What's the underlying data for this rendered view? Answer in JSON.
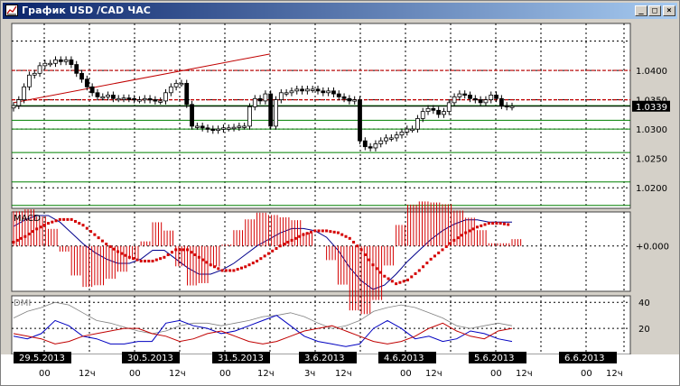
{
  "window": {
    "title": "График USD /CAD  ЧАС",
    "minimize_glyph": "_",
    "maximize_glyph": "□",
    "close_glyph": "×"
  },
  "colors": {
    "background": "#ffffff",
    "grid": "#000000",
    "resistance": "#c00000",
    "support": "#008000",
    "trendline": "#c00000",
    "candle": "#000000",
    "macd_line": "#00008b",
    "macd_signal": "#d40000",
    "macd_hist": "#d40000",
    "dmi_plus": "#0000c0",
    "dmi_minus": "#c00000",
    "dmi_adx": "#808080",
    "date_label_bg": "#000000",
    "date_label_fg": "#ffffff",
    "price_tag_bg": "#000000"
  },
  "price_panel": {
    "yaxis_labels": [
      "1.0400",
      "1.0350",
      "1.0300",
      "1.0250",
      "1.0200"
    ],
    "current_price_label": "1.0339"
  },
  "macd_panel": {
    "label": "MACD",
    "zero_label": "+0.000"
  },
  "dmi_panel": {
    "label": "DMI",
    "yaxis_labels": [
      "40",
      "20"
    ]
  },
  "time_axis": {
    "dates": [
      "29.5.2013",
      "30.5.2013",
      "31.5.2013",
      "3.6.2013",
      "4.6.2013",
      "5.6.2013",
      "6.6.2013"
    ],
    "hour_labels": [
      "00",
      "12ч",
      "00",
      "12ч",
      "00",
      "12ч",
      "3ч",
      "12ч",
      "00",
      "12ч",
      "00",
      "12ч",
      "00",
      "12ч"
    ]
  },
  "chart_data": {
    "type": "candlestick",
    "title": "График USD /CAD  ЧАС",
    "timeframe": "ЧАС",
    "ylim": [
      1.0165,
      1.048
    ],
    "horizontal_levels": {
      "resistance": [
        1.04,
        1.035
      ],
      "support": [
        1.034,
        1.0315,
        1.03,
        1.026,
        1.021,
        1.017
      ]
    },
    "trendline": {
      "from": {
        "date": "29.5.2013",
        "price": 1.0345
      },
      "to": {
        "date": "31.5.2013 ~12ч",
        "price": 1.0428
      }
    },
    "close_series_approx": [
      1.034,
      1.035,
      1.0372,
      1.0392,
      1.0395,
      1.0408,
      1.0412,
      1.0412,
      1.0418,
      1.0415,
      1.0418,
      1.041,
      1.0395,
      1.0385,
      1.0372,
      1.0362,
      1.0355,
      1.0355,
      1.0358,
      1.0352,
      1.0352,
      1.0353,
      1.0352,
      1.035,
      1.035,
      1.0352,
      1.035,
      1.0348,
      1.0348,
      1.0362,
      1.0372,
      1.0378,
      1.0378,
      1.0342,
      1.0305,
      1.0305,
      1.0302,
      1.03,
      1.0298,
      1.03,
      1.0302,
      1.0302,
      1.0303,
      1.0305,
      1.0305,
      1.0338,
      1.0352,
      1.0348,
      1.036,
      1.0305,
      1.035,
      1.0362,
      1.0362,
      1.0365,
      1.0368,
      1.0365,
      1.0368,
      1.0368,
      1.0365,
      1.0362,
      1.0365,
      1.036,
      1.0355,
      1.0352,
      1.0348,
      1.035,
      1.028,
      1.027,
      1.0268,
      1.0275,
      1.028,
      1.0285,
      1.0285,
      1.029,
      1.0295,
      1.03,
      1.03,
      1.0318,
      1.033,
      1.0335,
      1.0332,
      1.0325,
      1.033,
      1.0345,
      1.0355,
      1.036,
      1.0358,
      1.0352,
      1.035,
      1.0345,
      1.035,
      1.0358,
      1.0352,
      1.034,
      1.0338,
      1.0339
    ],
    "macd": {
      "signal_approx": [
        0.0002,
        0.0005,
        0.0009,
        0.0012,
        0.0014,
        0.0014,
        0.0011,
        0.0006,
        0.0001,
        -0.0003,
        -0.0006,
        -0.0008,
        -0.0008,
        -0.0006,
        -0.0002,
        -0.0002,
        -0.0006,
        -0.001,
        -0.0013,
        -0.0013,
        -0.0011,
        -0.0008,
        -0.0004,
        0.0,
        0.0003,
        0.0006,
        0.0008,
        0.0008,
        0.0007,
        0.0004,
        -0.0002,
        -0.001,
        -0.0016,
        -0.002,
        -0.0018,
        -0.0013,
        -0.0007,
        -0.0002,
        0.0003,
        0.0007,
        0.001,
        0.0012,
        0.0012,
        0.0011
      ]
    },
    "dmi": {
      "ylim": [
        0,
        45
      ],
      "adx_approx": [
        28,
        33,
        36,
        40,
        38,
        32,
        26,
        24,
        21,
        18,
        16,
        18,
        22,
        24,
        24,
        22,
        24,
        26,
        29,
        30,
        32,
        29,
        24,
        20,
        22,
        26,
        33,
        36,
        38,
        36,
        32,
        28,
        22,
        20,
        22,
        24,
        22
      ],
      "plus_di_approx": [
        14,
        12,
        16,
        26,
        22,
        14,
        12,
        8,
        8,
        10,
        10,
        24,
        26,
        22,
        20,
        16,
        18,
        22,
        26,
        30,
        22,
        14,
        10,
        8,
        6,
        8,
        20,
        26,
        20,
        12,
        14,
        10,
        12,
        18,
        16,
        12,
        10
      ],
      "minus_di_approx": [
        16,
        14,
        12,
        8,
        10,
        14,
        16,
        18,
        20,
        20,
        16,
        14,
        10,
        12,
        16,
        18,
        14,
        10,
        8,
        10,
        14,
        18,
        20,
        22,
        18,
        14,
        10,
        8,
        10,
        14,
        20,
        24,
        18,
        14,
        12,
        18,
        20
      ]
    }
  }
}
